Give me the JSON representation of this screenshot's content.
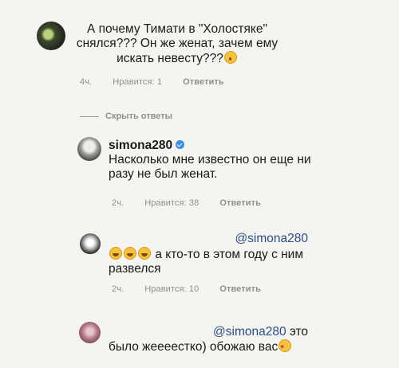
{
  "comment_main": {
    "text": "А почему Тимати в \"Холостяке\" снялся??? Он же женат, зачем ему искать невесту???",
    "emoji": "astonished-face",
    "time": "4ч.",
    "likes": "Нравится: 1",
    "reply_label": "Ответить"
  },
  "hide_replies_label": "Скрыть ответы",
  "reply_simona": {
    "username": "simona280",
    "verified": true,
    "text": "Насколько мне известно  он еще ни разу не был женат.",
    "time": "2ч.",
    "likes": "Нравится: 38",
    "reply_label": "Ответить"
  },
  "reply_two": {
    "mention": "@simona280",
    "emojis": [
      "tears-of-joy-face",
      "tears-of-joy-face",
      "tears-of-joy-face"
    ],
    "text": "а кто-то в этом году с ним развелся",
    "time": "2ч.",
    "likes": "Нравится: 10",
    "reply_label": "Ответить"
  },
  "reply_three": {
    "mention": "@simona280",
    "text_after_mention": " это",
    "text_line2": "было жеееестко) обожаю вас",
    "emoji": "heart-eyes-face"
  }
}
